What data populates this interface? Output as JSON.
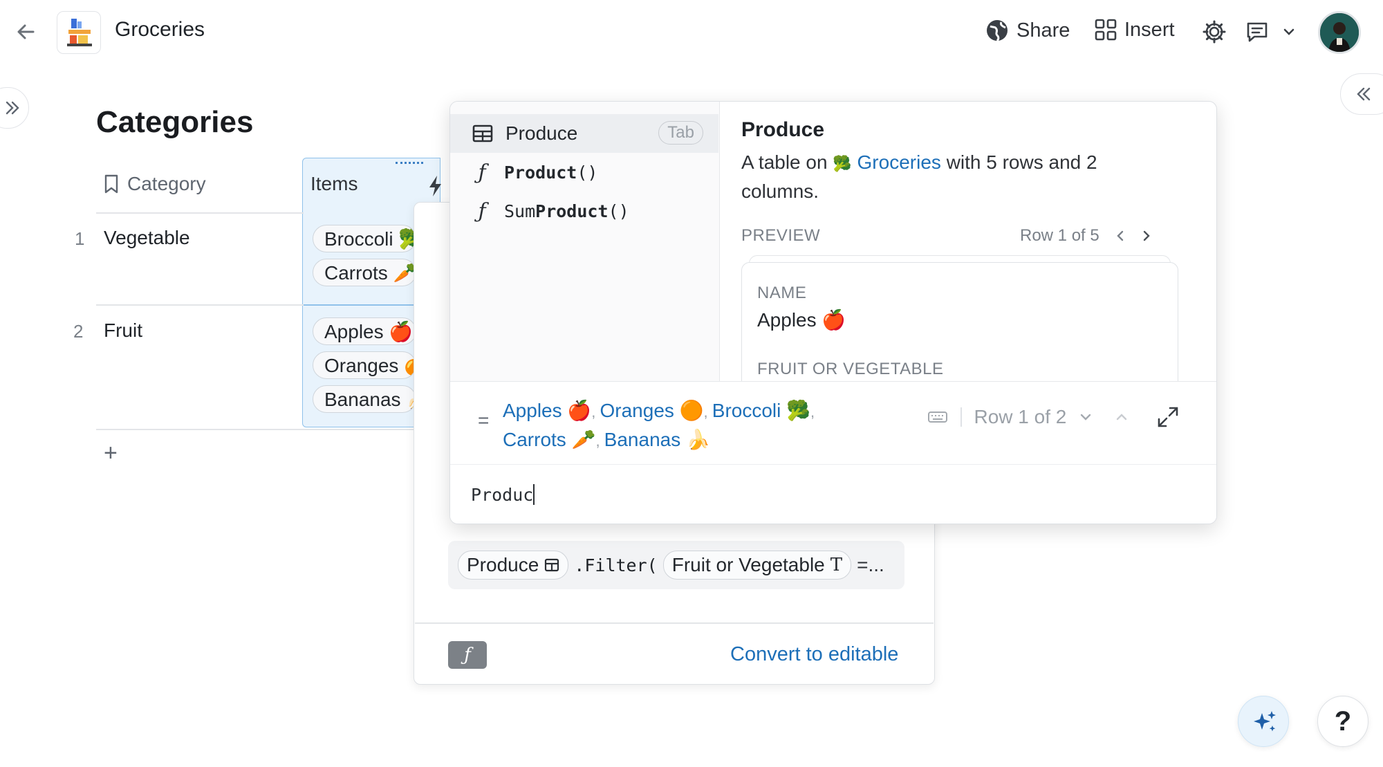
{
  "topbar": {
    "doc_title": "Groceries",
    "share_label": "Share",
    "insert_label": "Insert"
  },
  "categories_table": {
    "title": "Categories",
    "columns": [
      "Category",
      "Items"
    ],
    "rows": [
      {
        "num": "1",
        "category": "Vegetable",
        "items": [
          "Broccoli 🥦",
          "Carrots 🥕"
        ]
      },
      {
        "num": "2",
        "category": "Fruit",
        "items": [
          "Apples 🍎",
          "Oranges 🍊",
          "Bananas 🍌"
        ]
      }
    ],
    "add_row": "+"
  },
  "formula_editor": {
    "formula_parts": [
      "Produce",
      ".Filter(",
      "Fruit or Vegetable",
      "=..."
    ],
    "fx_label": "ƒ",
    "convert_label": "Convert to editable"
  },
  "autocomplete": {
    "suggestions": [
      {
        "label": "Produce",
        "kind": "table",
        "hint": "Tab"
      },
      {
        "label_bold": "Product",
        "label_rest": "()",
        "kind": "function"
      },
      {
        "label_pre": "Sum",
        "label_bold": "Product",
        "label_rest": "()",
        "kind": "function"
      }
    ],
    "detail": {
      "title": "Produce",
      "desc_pre": "A table on",
      "desc_link": "Groceries",
      "desc_post": "with 5 rows and 2 columns.",
      "preview_label": "PREVIEW",
      "row_pager": "Row 1 of 5",
      "fields": [
        {
          "label": "NAME",
          "value": "Apples 🍎"
        },
        {
          "label": "FRUIT OR VEGETABLE",
          "value": ""
        }
      ]
    },
    "result": {
      "eq": "=",
      "values": [
        "Apples 🍎",
        "Oranges 🟠",
        "Broccoli 🥦",
        "Carrots 🥕",
        "Bananas 🍌"
      ],
      "row_pager": "Row 1 of 2"
    },
    "input_text": "Produc"
  },
  "help_label": "?",
  "colors": {
    "accent": "#1d6fb8",
    "selected_column_bg": "#e8f3fc",
    "selected_column_border": "#8fc1ea"
  }
}
